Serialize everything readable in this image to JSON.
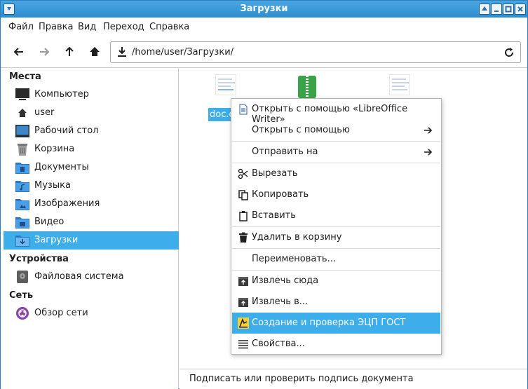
{
  "window": {
    "title": "Загрузки"
  },
  "menubar": {
    "items": [
      "Файл",
      "Правка",
      "Вид",
      "Переход",
      "Справка"
    ]
  },
  "toolbar": {
    "address_path": "/home/user/Загрузки/"
  },
  "sidebar": {
    "sections": {
      "places": "Места",
      "devices": "Устройства",
      "network": "Сеть"
    },
    "places": [
      {
        "label": "Компьютер",
        "icon": "monitor-icon"
      },
      {
        "label": "user",
        "icon": "home-icon"
      },
      {
        "label": "Рабочий стол",
        "icon": "desktop-icon"
      },
      {
        "label": "Корзина",
        "icon": "trash-icon"
      },
      {
        "label": "Документы",
        "icon": "folder-documents-icon"
      },
      {
        "label": "Музыка",
        "icon": "folder-music-icon"
      },
      {
        "label": "Изображения",
        "icon": "folder-pictures-icon"
      },
      {
        "label": "Видео",
        "icon": "folder-video-icon"
      },
      {
        "label": "Загрузки",
        "icon": "folder-downloads-icon",
        "active": true
      }
    ],
    "devices": [
      {
        "label": "Файловая система",
        "icon": "drive-icon"
      }
    ],
    "network": [
      {
        "label": "Обзор сети",
        "icon": "network-icon"
      }
    ]
  },
  "content": {
    "selected_file_label": "doc.d"
  },
  "context_menu": {
    "items": [
      {
        "label": "Открыть с помощью «LibreOffice Writer»",
        "icon": "document-icon"
      },
      {
        "label": "Открыть с помощью",
        "submenu": true
      },
      {
        "label": "Отправить на",
        "submenu": true
      },
      {
        "label": "Вырезать",
        "icon": "scissors-icon"
      },
      {
        "label": "Копировать",
        "icon": "copy-icon"
      },
      {
        "label": "Вставить",
        "icon": "paste-icon"
      },
      {
        "label": "Удалить в корзину",
        "icon": "trash-icon"
      },
      {
        "label": "Переименовать..."
      },
      {
        "label": "Извлечь сюда",
        "icon": "extract-icon"
      },
      {
        "label": "Извлечь в...",
        "icon": "extract-icon"
      },
      {
        "label": "Создание и проверка ЭЦП ГОСТ",
        "icon": "signature-icon",
        "highlighted": true
      },
      {
        "label": "Свойства...",
        "icon": "properties-icon"
      }
    ]
  },
  "statusbar": {
    "text": "Подписать или проверить подпись документа"
  },
  "colors": {
    "accent": "#3daee9",
    "titlebar": "#2e8dd0",
    "zip_green": "#3aa34a"
  }
}
